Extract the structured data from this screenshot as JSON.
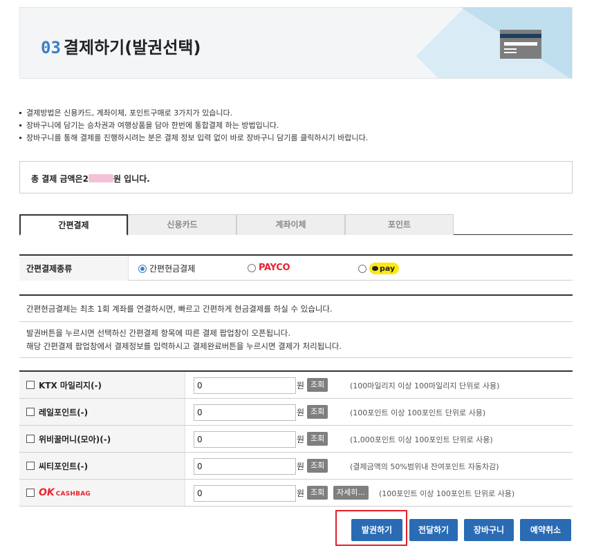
{
  "header": {
    "step_num": "03",
    "title": "결제하기(발권선택)"
  },
  "notices": [
    "결제방법은 신용카드, 계좌이체, 포인트구매로 3가지가 있습니다.",
    "장바구니에 담기는 승차권과 여행상품을 담아 한번에 통합결제 하는 방법입니다.",
    "장바구니를 통해 결제를 진행하시려는 분은 결제 정보 입력 없이 바로 장바구니 담기를 클릭하시기 바랍니다."
  ],
  "total": {
    "prefix": "총 결제 금액은",
    "amount_visible": "2",
    "suffix": "원 입니다."
  },
  "tabs": [
    {
      "label": "간편결제",
      "active": true
    },
    {
      "label": "신용카드",
      "active": false
    },
    {
      "label": "계좌이체",
      "active": false
    },
    {
      "label": "포인트",
      "active": false
    }
  ],
  "easy_pay": {
    "label": "간편결제종류",
    "options": [
      {
        "label": "간편현금결제",
        "selected": true
      },
      {
        "label": "PAYCO",
        "selected": false
      },
      {
        "label": "pay",
        "selected": false
      }
    ]
  },
  "info": {
    "line1": "간편현금결제는 최초 1회 계좌를 연결하시면, 빠르고 간편하게 현금결제를 하실 수 있습니다.",
    "line2": "발권버튼을 누르시면 선택하신 간편결제 항목에 따른 결제 팝업창이 오픈됩니다.",
    "line3": "해당 간편결제 팝업창에서 결제정보를 입력하시고 결제완료버튼을 누르시면 결제가 처리됩니다."
  },
  "points": [
    {
      "label": "KTX 마일리지(-)",
      "value": "0",
      "unit": "원",
      "query": "조회",
      "desc": "(100마일리지 이상 100마일리지 단위로 사용)"
    },
    {
      "label": "레일포인트(-)",
      "value": "0",
      "unit": "원",
      "query": "조회",
      "desc": "(100포인트 이상 100포인트 단위로 사용)"
    },
    {
      "label": "위비꿀머니(모아)(-)",
      "value": "0",
      "unit": "원",
      "query": "조회",
      "desc": "(1,000포인트 이상 100포인트 단위로 사용)"
    },
    {
      "label": "씨티포인트(-)",
      "value": "0",
      "unit": "원",
      "query": "조회",
      "desc": "(결제금액의 50%범위내 잔여포인트 자동차감)"
    },
    {
      "label_ok": "OK",
      "label_cb": "CASHBAG",
      "value": "0",
      "unit": "원",
      "query": "조회",
      "detail": "자세히...",
      "desc": "(100포인트 이상 100포인트 단위로 사용)"
    }
  ],
  "actions": {
    "issue": "발권하기",
    "transfer": "전달하기",
    "cart": "장바구니",
    "cancel": "예약취소"
  },
  "colors": {
    "accent": "#3b7fc4",
    "button": "#2a6bb4",
    "highlight": "#e21f26",
    "payco": "#e8232d",
    "kakao": "#ffe812"
  }
}
